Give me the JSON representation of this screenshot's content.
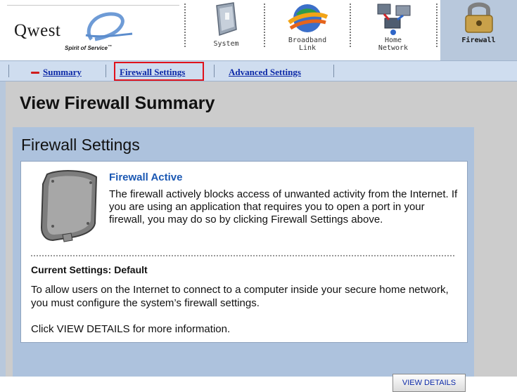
{
  "brand": {
    "name": "Qwest",
    "tagline": "Spirit of Service"
  },
  "nav": {
    "tabs": [
      {
        "label_lines": [
          "System"
        ],
        "icon": "system-icon"
      },
      {
        "label_lines": [
          "Broadband",
          "Link"
        ],
        "icon": "broadband-globe-icon"
      },
      {
        "label_lines": [
          "Home",
          "Network"
        ],
        "icon": "home-network-icon"
      },
      {
        "label_lines": [
          "Firewall"
        ],
        "icon": "firewall-lock-icon",
        "active": true
      }
    ]
  },
  "subnav": {
    "summary": "Summary",
    "firewall_settings": "Firewall Settings",
    "advanced_settings": "Advanced Settings"
  },
  "page": {
    "title": "View Firewall Summary"
  },
  "panel": {
    "title": "Firewall Settings",
    "status_title": "Firewall Active",
    "status_text": "The firewall actively blocks access of unwanted activity from the Internet. If you are using an application that requires you to open a port in your firewall, you may do so by clicking Firewall Settings above.",
    "current_settings": "Current Settings: Default",
    "settings_text": "To allow users on the Internet to connect to a computer inside your secure home network, you must configure the system’s firewall settings.",
    "details_text": "Click VIEW DETAILS for more information.",
    "view_details_button": "VIEW DETAILS"
  },
  "colors": {
    "link": "#0d2aa8",
    "status_title": "#1b58b3",
    "highlight": "#e0121b",
    "panel_bg": "#adc2dd",
    "subnav_bg": "#cfddef",
    "active_tab_bg": "#b8c8dc"
  }
}
